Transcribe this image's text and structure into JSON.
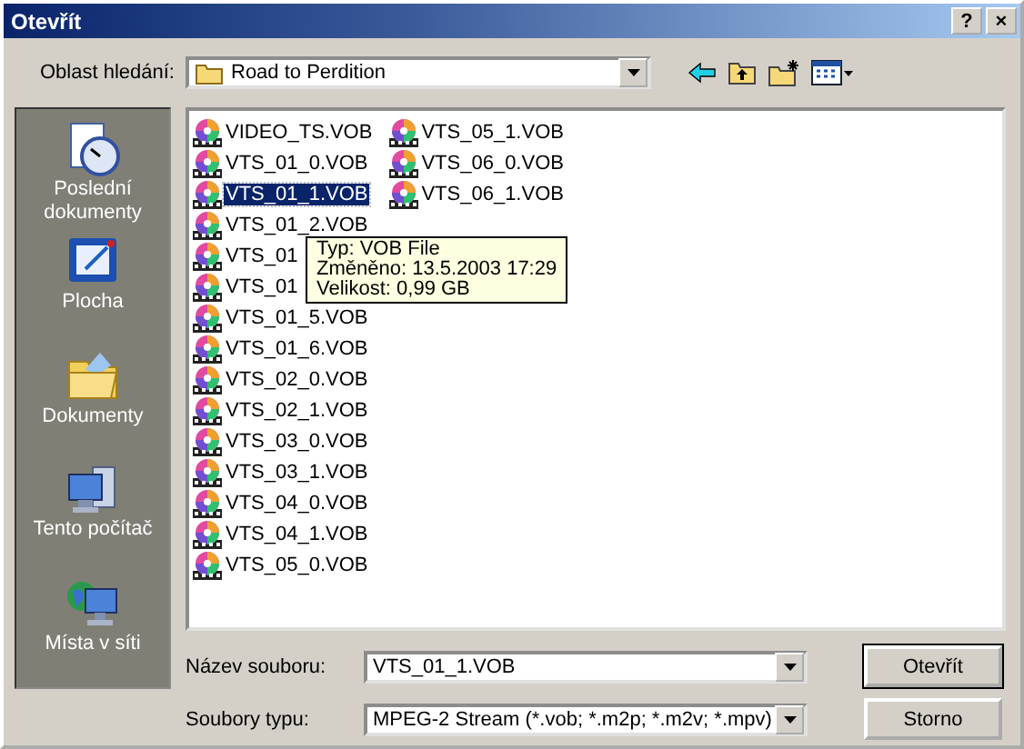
{
  "window": {
    "title": "Otevřít",
    "buttons": [
      "?",
      "×"
    ]
  },
  "look_in": {
    "label": "Oblast hledání:",
    "value": "Road to Perdition"
  },
  "places": [
    {
      "label": "Poslední dokumenty",
      "kind": "recent"
    },
    {
      "label": "Plocha",
      "kind": "desktop"
    },
    {
      "label": "Dokumenty",
      "kind": "documents"
    },
    {
      "label": "Tento počítač",
      "kind": "computer"
    },
    {
      "label": "Místa v síti",
      "kind": "network"
    }
  ],
  "files": [
    {
      "name": "VIDEO_TS.VOB",
      "selected": false
    },
    {
      "name": "VTS_01_0.VOB",
      "selected": false
    },
    {
      "name": "VTS_01_1.VOB",
      "selected": true
    },
    {
      "name": "VTS_01_2.VOB",
      "selected": false
    },
    {
      "name": "VTS_01",
      "selected": false
    },
    {
      "name": "VTS_01",
      "selected": false
    },
    {
      "name": "VTS_01_5.VOB",
      "selected": false
    },
    {
      "name": "VTS_01_6.VOB",
      "selected": false
    },
    {
      "name": "VTS_02_0.VOB",
      "selected": false
    },
    {
      "name": "VTS_02_1.VOB",
      "selected": false
    },
    {
      "name": "VTS_03_0.VOB",
      "selected": false
    },
    {
      "name": "VTS_03_1.VOB",
      "selected": false
    },
    {
      "name": "VTS_04_0.VOB",
      "selected": false
    },
    {
      "name": "VTS_04_1.VOB",
      "selected": false
    },
    {
      "name": "VTS_05_0.VOB",
      "selected": false
    },
    {
      "name": "VTS_05_1.VOB",
      "selected": false
    },
    {
      "name": "VTS_06_0.VOB",
      "selected": false
    },
    {
      "name": "VTS_06_1.VOB",
      "selected": false
    }
  ],
  "tooltip": [
    "Typ: VOB File",
    "Změněno: 13.5.2003 17:29",
    "Velikost: 0,99 GB"
  ],
  "file_name": {
    "label": "Název souboru:",
    "value": "VTS_01_1.VOB"
  },
  "file_type": {
    "label": "Soubory typu:",
    "value": "MPEG-2 Stream (*.vob; *.m2p; *.m2v; *.mpv)"
  },
  "buttons": [
    "Otevřít",
    "Storno"
  ]
}
